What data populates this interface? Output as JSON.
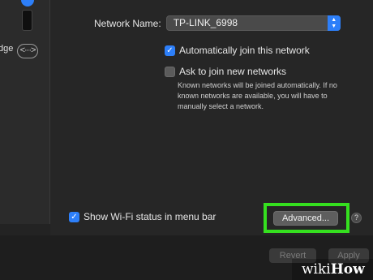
{
  "sidebar": {
    "label_fragment": "dge",
    "bridge_icon_glyph": "<···>"
  },
  "network": {
    "name_label": "Network Name:",
    "name_value": "TP-LINK_6998"
  },
  "options": {
    "auto_join_label": "Automatically join this network",
    "auto_join_checked": true,
    "ask_join_label": "Ask to join new networks",
    "ask_join_checked": false,
    "description": "Known networks will be joined automatically. If no known networks are available, you will have to manually select a network.",
    "show_wifi_label": "Show Wi-Fi status in menu bar",
    "show_wifi_checked": true
  },
  "buttons": {
    "advanced_label": "Advanced...",
    "help_label": "?",
    "revert_label": "Revert",
    "apply_label": "Apply"
  },
  "watermark": {
    "part1": "wiki",
    "part2": "How"
  },
  "colors": {
    "accent": "#2d7ff9",
    "highlight": "#35e01f",
    "panel": "#262626"
  }
}
